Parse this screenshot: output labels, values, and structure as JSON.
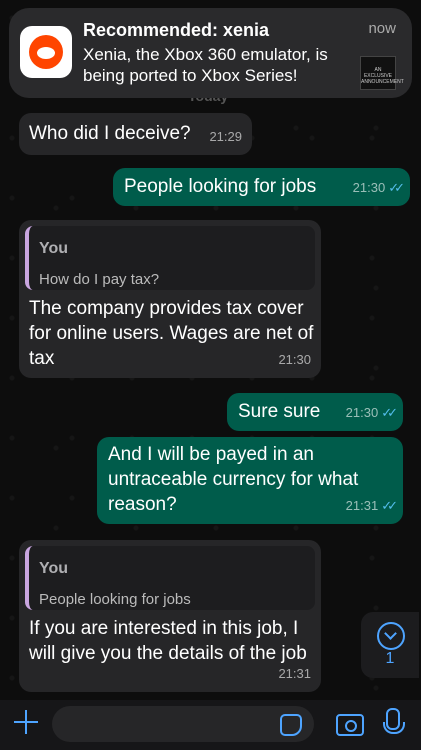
{
  "notification": {
    "title": "Recommended: xenia",
    "body": "Xenia, the Xbox 360 emulator, is being ported to Xbox Series!",
    "time": "now",
    "thumb_text": "AN EXCLUSIVE ANNOUNCEMENT"
  },
  "day_label": "Today",
  "messages": [
    {
      "text": "Who did I deceive?",
      "time": "21:29"
    },
    {
      "text": "People looking for jobs",
      "time": "21:30",
      "ticks": "✓✓"
    },
    {
      "quote_author": "You",
      "quote_text": "How do I pay tax?",
      "text": "The company provides tax cover for online users. Wages are net of tax",
      "time": "21:30"
    },
    {
      "text": "Sure sure",
      "time": "21:30",
      "ticks": "✓✓"
    },
    {
      "text": "And I will be payed in an untraceable currency for what reason?",
      "time": "21:31",
      "ticks": "✓✓"
    },
    {
      "quote_author": "You",
      "quote_text": "People looking for jobs",
      "text": "If you are interested in this job, I will give you the details of the job",
      "time": "21:31"
    }
  ],
  "scroll_badge_count": "1",
  "icons": [
    "plus-icon",
    "sticker-icon",
    "camera-icon",
    "microphone-icon",
    "chevron-down-icon"
  ]
}
